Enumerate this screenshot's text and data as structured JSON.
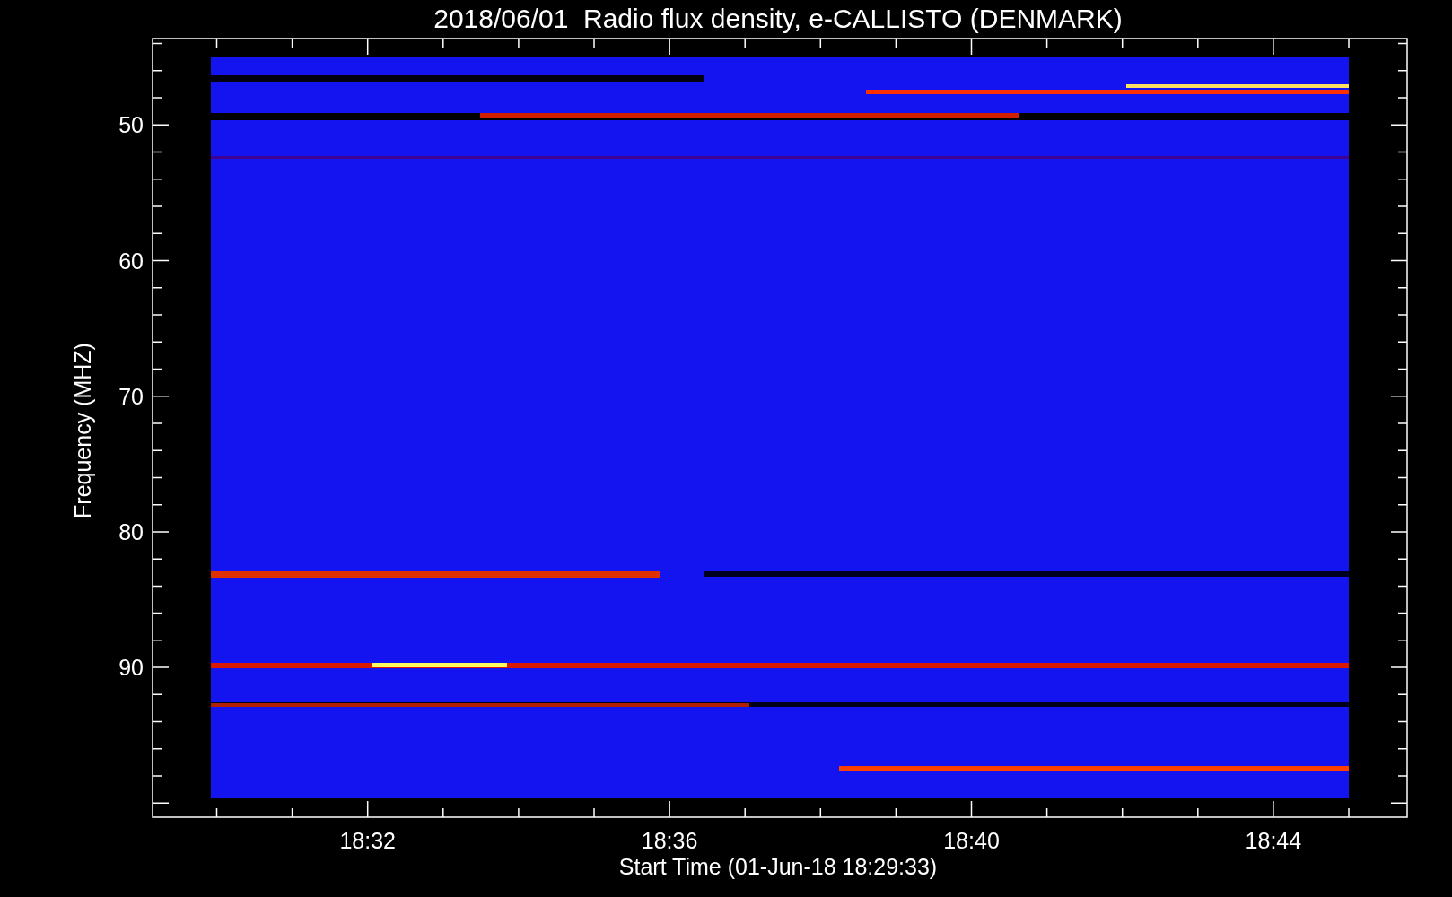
{
  "title": "2018/06/01  Radio flux density, e-CALLISTO (DENMARK)",
  "ylabel": "Frequency (MHZ)",
  "xlabel": "Start Time (01-Jun-18 18:29:33)",
  "yticks": [
    "50",
    "60",
    "70",
    "80",
    "90"
  ],
  "xticks": [
    "18:32",
    "18:36",
    "18:40",
    "18:44"
  ]
}
